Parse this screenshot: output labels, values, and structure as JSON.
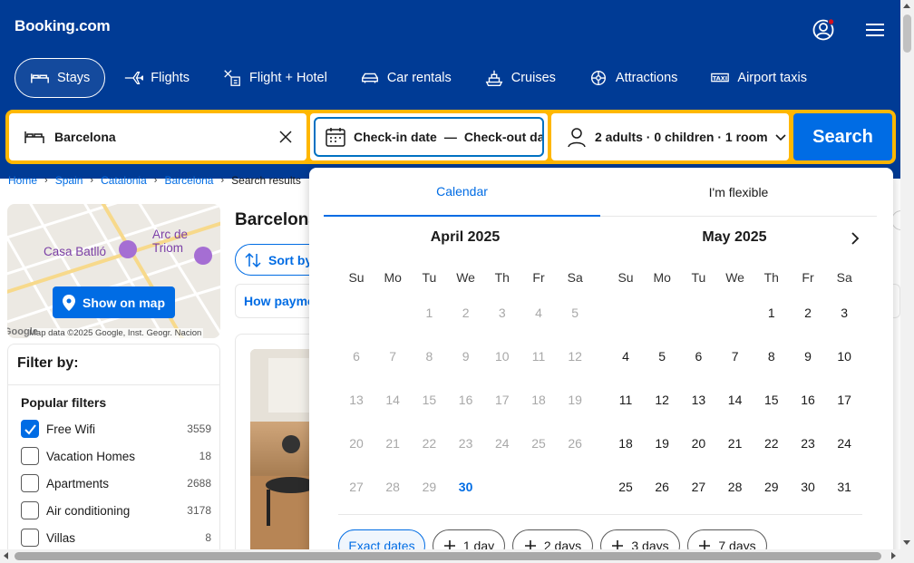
{
  "header": {
    "logo": "Booking.com",
    "nav": [
      {
        "label": "Stays",
        "icon": "bed-icon",
        "active": true
      },
      {
        "label": "Flights",
        "icon": "airplane-icon"
      },
      {
        "label": "Flight + Hotel",
        "icon": "flight-hotel-icon"
      },
      {
        "label": "Car rentals",
        "icon": "car-icon"
      },
      {
        "label": "Cruises",
        "icon": "cruise-icon"
      },
      {
        "label": "Attractions",
        "icon": "attractions-icon"
      },
      {
        "label": "Airport taxis",
        "icon": "taxi-icon"
      }
    ]
  },
  "search": {
    "destination": "Barcelona",
    "checkin": "Check-in date",
    "dash": "—",
    "checkout": "Check-out date",
    "guests": "2 adults · 0 children · 1 room",
    "button": "Search"
  },
  "breadcrumb": [
    "Home",
    "Spain",
    "Catalonia",
    "Barcelona",
    "Search results"
  ],
  "map": {
    "button": "Show on map",
    "labels": [
      "Arc de Triom",
      "Casa Batlló"
    ],
    "credit": "Map data ©2025 Google, Inst. Geogr. Nacion",
    "google": "Google"
  },
  "filter": {
    "title": "Filter by:",
    "section": "Popular filters",
    "items": [
      {
        "label": "Free Wifi",
        "count": "3559",
        "checked": true
      },
      {
        "label": "Vacation Homes",
        "count": "18",
        "checked": false
      },
      {
        "label": "Apartments",
        "count": "2688",
        "checked": false
      },
      {
        "label": "Air conditioning",
        "count": "3178",
        "checked": false
      },
      {
        "label": "Villas",
        "count": "8",
        "checked": false
      }
    ]
  },
  "results": {
    "title": "Barcelona",
    "sort": "Sort by",
    "payment": "How payment"
  },
  "calendar": {
    "tabs": [
      "Calendar",
      "I'm flexible"
    ],
    "weekdays": [
      "Su",
      "Mo",
      "Tu",
      "We",
      "Th",
      "Fr",
      "Sa"
    ],
    "months": [
      {
        "title": "April 2025",
        "weeks": [
          [
            "",
            "",
            "1",
            "2",
            "3",
            "4",
            "5"
          ],
          [
            "6",
            "7",
            "8",
            "9",
            "10",
            "11",
            "12"
          ],
          [
            "13",
            "14",
            "15",
            "16",
            "17",
            "18",
            "19"
          ],
          [
            "20",
            "21",
            "22",
            "23",
            "24",
            "25",
            "26"
          ],
          [
            "27",
            "28",
            "29",
            "30",
            "",
            "",
            ""
          ]
        ],
        "today": "30"
      },
      {
        "title": "May 2025",
        "weeks": [
          [
            "",
            "",
            "",
            "",
            "1",
            "2",
            "3"
          ],
          [
            "4",
            "5",
            "6",
            "7",
            "8",
            "9",
            "10"
          ],
          [
            "11",
            "12",
            "13",
            "14",
            "15",
            "16",
            "17"
          ],
          [
            "18",
            "19",
            "20",
            "21",
            "22",
            "23",
            "24"
          ],
          [
            "25",
            "26",
            "27",
            "28",
            "29",
            "30",
            "31"
          ]
        ]
      }
    ],
    "chips": [
      "Exact dates",
      "1 day",
      "2 days",
      "3 days",
      "7 days"
    ]
  },
  "colors": {
    "brand": "#003b95",
    "accent": "#006ce4",
    "highlight": "#ffb700"
  }
}
